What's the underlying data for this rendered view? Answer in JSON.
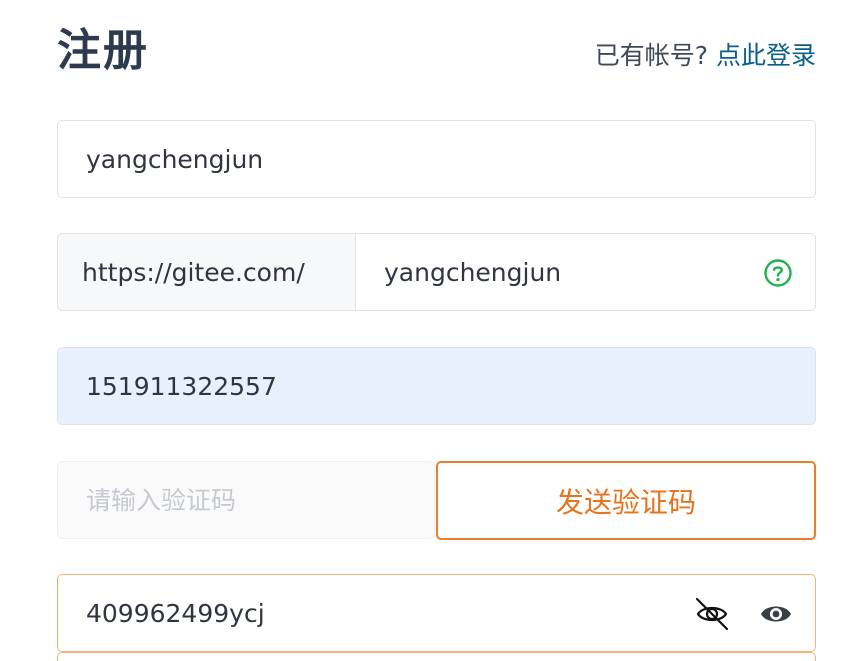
{
  "header": {
    "title": "注册",
    "login_prompt": "已有帐号?",
    "login_link": "点此登录"
  },
  "form": {
    "username": {
      "value": "yangchengjun"
    },
    "space": {
      "prefix": "https://gitee.com/",
      "value": "yangchengjun",
      "status_icon": "help-circle-icon"
    },
    "phone": {
      "value": "151911322557"
    },
    "verify_code": {
      "value": "",
      "placeholder": "请输入验证码",
      "send_button": "发送验证码"
    },
    "password": {
      "value": "409962499ycj",
      "icons": [
        "eye-off-icon",
        "eye-icon"
      ]
    }
  },
  "colors": {
    "title": "#2e3a4d",
    "link": "#0b5f8a",
    "accent": "#ee7d2a",
    "help_icon": "#22b14c",
    "autofill_bg": "#e8f0fe"
  }
}
